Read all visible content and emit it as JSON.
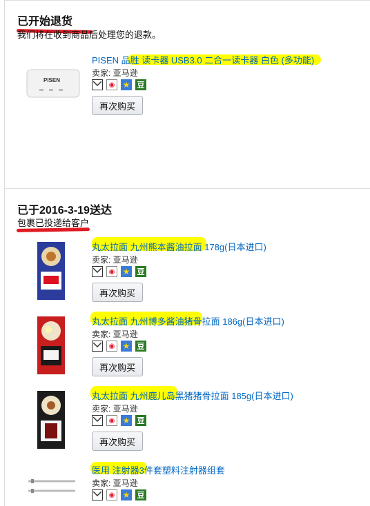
{
  "sections": [
    {
      "heading": "已开始退货",
      "subtext": "我们将在收到商品后处理您的退款。",
      "items": [
        {
          "title": "PISEN 品胜 读卡器 USB3.0 二合一读卡器 白色 (多功能)",
          "seller": "卖家: 亚马逊",
          "button": "再次购买",
          "thumb": "card-reader"
        }
      ]
    },
    {
      "heading": "已于2016-3-19送达",
      "subtext": "包裹已投递给客户",
      "items": [
        {
          "title": "丸太拉面 九州熊本酱油拉面 178g(日本进口)",
          "seller": "卖家: 亚马逊",
          "button": "再次购买",
          "thumb": "ramen-blue"
        },
        {
          "title": "丸太拉面 九州博多酱油猪骨拉面 186g(日本进口)",
          "seller": "卖家: 亚马逊",
          "button": "再次购买",
          "thumb": "ramen-red"
        },
        {
          "title": "丸太拉面 九州鹿儿岛黑猪猪骨拉面 185g(日本进口)",
          "seller": "卖家: 亚马逊",
          "button": "再次购买",
          "thumb": "ramen-dark"
        },
        {
          "title": "医用 注射器3件套塑料注射器组套",
          "seller": "卖家: 亚马逊",
          "thumb": "syringe"
        }
      ]
    }
  ],
  "share_icons": [
    "mail-icon",
    "weibo-icon",
    "qzone-icon",
    "douban-icon"
  ],
  "share_icon_glyphs": {
    "qzone": "★",
    "douban": "豆",
    "weibo": "◉"
  },
  "colors": {
    "link": "#0066c0",
    "highlight": "#ffff00",
    "underline": "#e01b24"
  }
}
